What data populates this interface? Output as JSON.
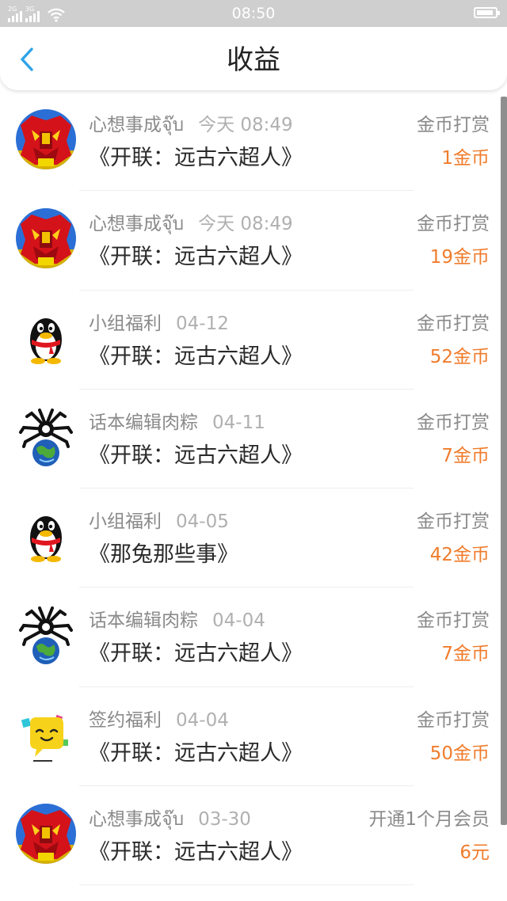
{
  "status_bar": {
    "time": "08:50",
    "sim1": "2G",
    "sim2": "3G"
  },
  "header": {
    "title": "收益"
  },
  "colors": {
    "amount": "#f07c2c",
    "back_arrow": "#2ea3e8"
  },
  "items": [
    {
      "avatar": "red-mecha-avatar",
      "sender": "心想事成จุ๊บ",
      "time": "今天 08:49",
      "book": "《开联：远古六超人》",
      "type": "金币打赏",
      "amount": "1金币"
    },
    {
      "avatar": "red-mecha-avatar",
      "sender": "心想事成จุ๊บ",
      "time": "今天 08:49",
      "book": "《开联：远古六超人》",
      "type": "金币打赏",
      "amount": "19金币"
    },
    {
      "avatar": "penguin-avatar",
      "sender": "小组福利",
      "time": "04-12",
      "book": "《开联：远古六超人》",
      "type": "金币打赏",
      "amount": "52金币"
    },
    {
      "avatar": "spider-globe-avatar",
      "sender": "话本编辑肉粽",
      "time": "04-11",
      "book": "《开联：远古六超人》",
      "type": "金币打赏",
      "amount": "7金币"
    },
    {
      "avatar": "penguin-avatar",
      "sender": "小组福利",
      "time": "04-05",
      "book": "《那兔那些事》",
      "type": "金币打赏",
      "amount": "42金币"
    },
    {
      "avatar": "spider-globe-avatar",
      "sender": "话本编辑肉粽",
      "time": "04-04",
      "book": "《开联：远古六超人》",
      "type": "金币打赏",
      "amount": "7金币"
    },
    {
      "avatar": "chat-bubble-avatar",
      "sender": "签约福利",
      "time": "04-04",
      "book": "《开联：远古六超人》",
      "type": "金币打赏",
      "amount": "50金币"
    },
    {
      "avatar": "red-mecha-avatar",
      "sender": "心想事成จุ๊บ",
      "time": "03-30",
      "book": "《开联：远古六超人》",
      "type": "开通1个月会员",
      "amount": "6元"
    }
  ]
}
